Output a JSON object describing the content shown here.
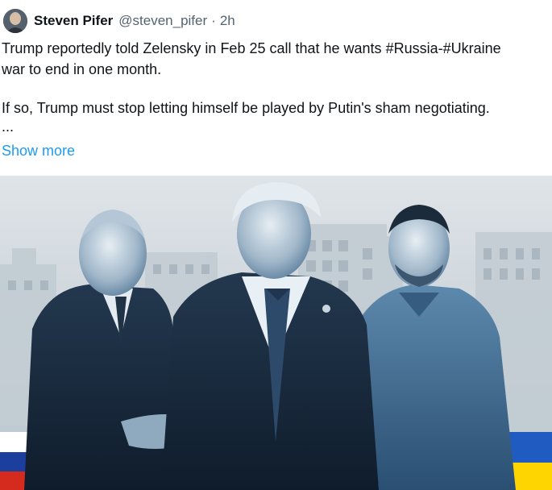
{
  "author": {
    "name": "Steven Pifer",
    "handle": "@steven_pifer",
    "separator": "·",
    "time": "2h"
  },
  "tweet": {
    "line1_pre": "Trump reportedly told Zelensky in Feb 25 call that he wants ",
    "hashtag_russia": "#Russia",
    "dash": "-",
    "hashtag_ukraine": "#Ukraine",
    "line2": "war to end in one month.",
    "paragraph2": "If so, Trump must stop letting himself be played by Putin's sham negotiating.",
    "ellipsis": "...",
    "show_more": "Show more"
  },
  "media": {
    "subjects": [
      "putin-figure",
      "trump-figure",
      "zelensky-figure"
    ],
    "flags": [
      "russia-flag",
      "ukraine-flag"
    ],
    "colors": {
      "russia_white": "#ffffff",
      "russia_blue": "#1c3f9e",
      "russia_red": "#d52b1e",
      "ukraine_blue": "#1f5bc0",
      "ukraine_yellow": "#ffd500",
      "duotone_dark": "#1a2a3d",
      "duotone_mid": "#3f6f99"
    }
  }
}
